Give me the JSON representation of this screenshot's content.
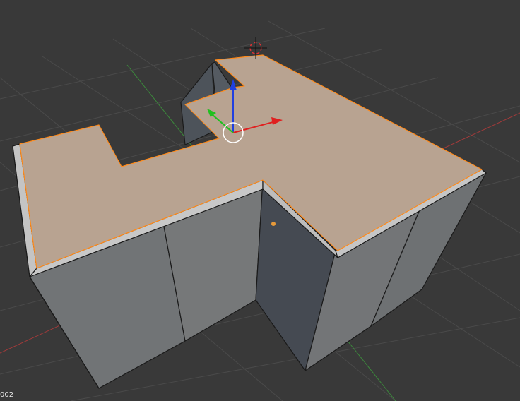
{
  "viewport": {
    "object_name_fragment": "002",
    "colors": {
      "background": "#393939",
      "grid": "#4a4a4a",
      "x_axis": "#a33a3a",
      "y_axis": "#3c8a3c",
      "top_face_selected": "#b8a391",
      "side_light": "#747678",
      "side_dark": "#4b4f56",
      "bevel": "#c4c4c4",
      "selection_edge": "#ff8a1a",
      "gizmo_x": "#e02020",
      "gizmo_y": "#20c020",
      "gizmo_z": "#2040e0"
    }
  }
}
